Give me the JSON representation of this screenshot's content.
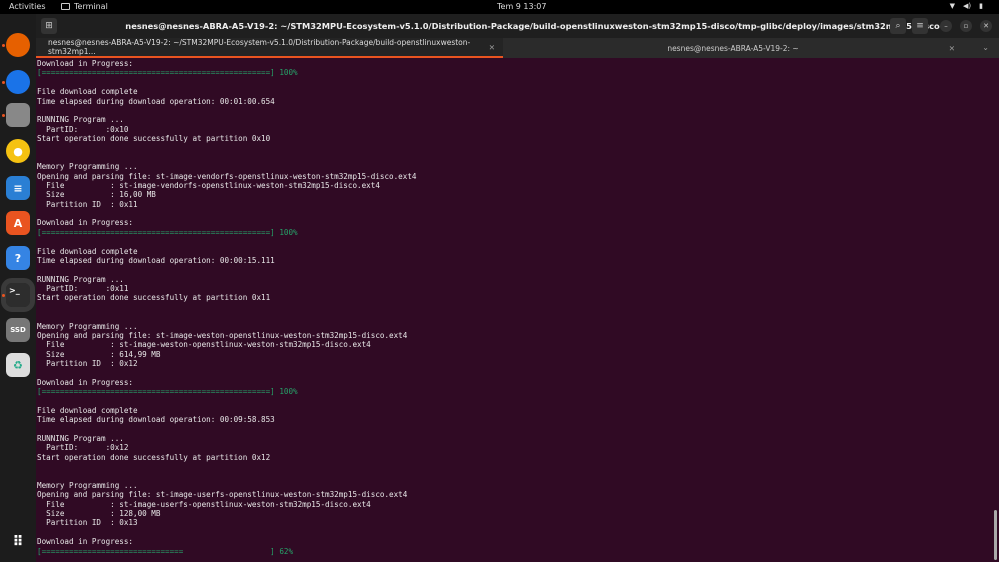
{
  "topbar": {
    "activities": "Activities",
    "app": "Terminal",
    "clock": "Tem 9  13:07",
    "tray": [
      "wifi",
      "volume",
      "battery"
    ]
  },
  "dock": [
    {
      "name": "firefox",
      "glyph": "",
      "color": "#e66000"
    },
    {
      "name": "thunderbird",
      "glyph": "",
      "color": "#1a73e8"
    },
    {
      "name": "files",
      "glyph": "",
      "color": "#888"
    },
    {
      "name": "rhythmbox",
      "glyph": "●",
      "color": "#f5c211"
    },
    {
      "name": "writer",
      "glyph": "≡",
      "color": "#2a7fd4"
    },
    {
      "name": "app-center",
      "glyph": "A",
      "color": "#e95420"
    },
    {
      "name": "help",
      "glyph": "?",
      "color": "#3584e4"
    },
    {
      "name": "terminal",
      "glyph": ">_",
      "color": "#2d2d2d"
    },
    {
      "name": "ssd",
      "glyph": "SSD",
      "color": "#777"
    },
    {
      "name": "trash",
      "glyph": "♻",
      "color": "#ddd"
    }
  ],
  "window": {
    "title": "nesnes@nesnes-ABRA-A5-V19-2: ~/STM32MPU-Ecosystem-v5.1.0/Distribution-Package/build-openstlinuxweston-stm32mp15-disco/tmp-glibc/deploy/images/stm32mp15-disco",
    "tabs": [
      {
        "label": "nesnes@nesnes-ABRA-A5-V19-2: ~/STM32MPU-Ecosystem-v5.1.0/Distribution-Package/build-openstlinuxweston-stm32mp1..."
      },
      {
        "label": "nesnes@nesnes-ABRA-A5-V19-2: ~"
      }
    ]
  },
  "terminal": {
    "lines": [
      "Download in Progress:",
      {
        "bar": "==================================================",
        "pct": "100%"
      },
      "",
      "File download complete",
      "Time elapsed during download operation: 00:01:00.654",
      "",
      "RUNNING Program ...",
      "  PartID:      :0x10",
      "Start operation done successfully at partition 0x10",
      "",
      "",
      "Memory Programming ...",
      "Opening and parsing file: st-image-vendorfs-openstlinux-weston-stm32mp15-disco.ext4",
      "  File          : st-image-vendorfs-openstlinux-weston-stm32mp15-disco.ext4",
      "  Size          : 16,00 MB",
      "  Partition ID  : 0x11",
      "",
      "Download in Progress:",
      {
        "bar": "==================================================",
        "pct": "100%"
      },
      "",
      "File download complete",
      "Time elapsed during download operation: 00:00:15.111",
      "",
      "RUNNING Program ...",
      "  PartID:      :0x11",
      "Start operation done successfully at partition 0x11",
      "",
      "",
      "Memory Programming ...",
      "Opening and parsing file: st-image-weston-openstlinux-weston-stm32mp15-disco.ext4",
      "  File          : st-image-weston-openstlinux-weston-stm32mp15-disco.ext4",
      "  Size          : 614,99 MB",
      "  Partition ID  : 0x12",
      "",
      "Download in Progress:",
      {
        "bar": "==================================================",
        "pct": "100%"
      },
      "",
      "File download complete",
      "Time elapsed during download operation: 00:09:58.853",
      "",
      "RUNNING Program ...",
      "  PartID:      :0x12",
      "Start operation done successfully at partition 0x12",
      "",
      "",
      "Memory Programming ...",
      "Opening and parsing file: st-image-userfs-openstlinux-weston-stm32mp15-disco.ext4",
      "  File          : st-image-userfs-openstlinux-weston-stm32mp15-disco.ext4",
      "  Size          : 128,00 MB",
      "  Partition ID  : 0x13",
      "",
      "Download in Progress:",
      {
        "bar": "===============================                   ",
        "pct": "62%"
      }
    ]
  },
  "progress": {
    "current_download_percent": 62
  }
}
